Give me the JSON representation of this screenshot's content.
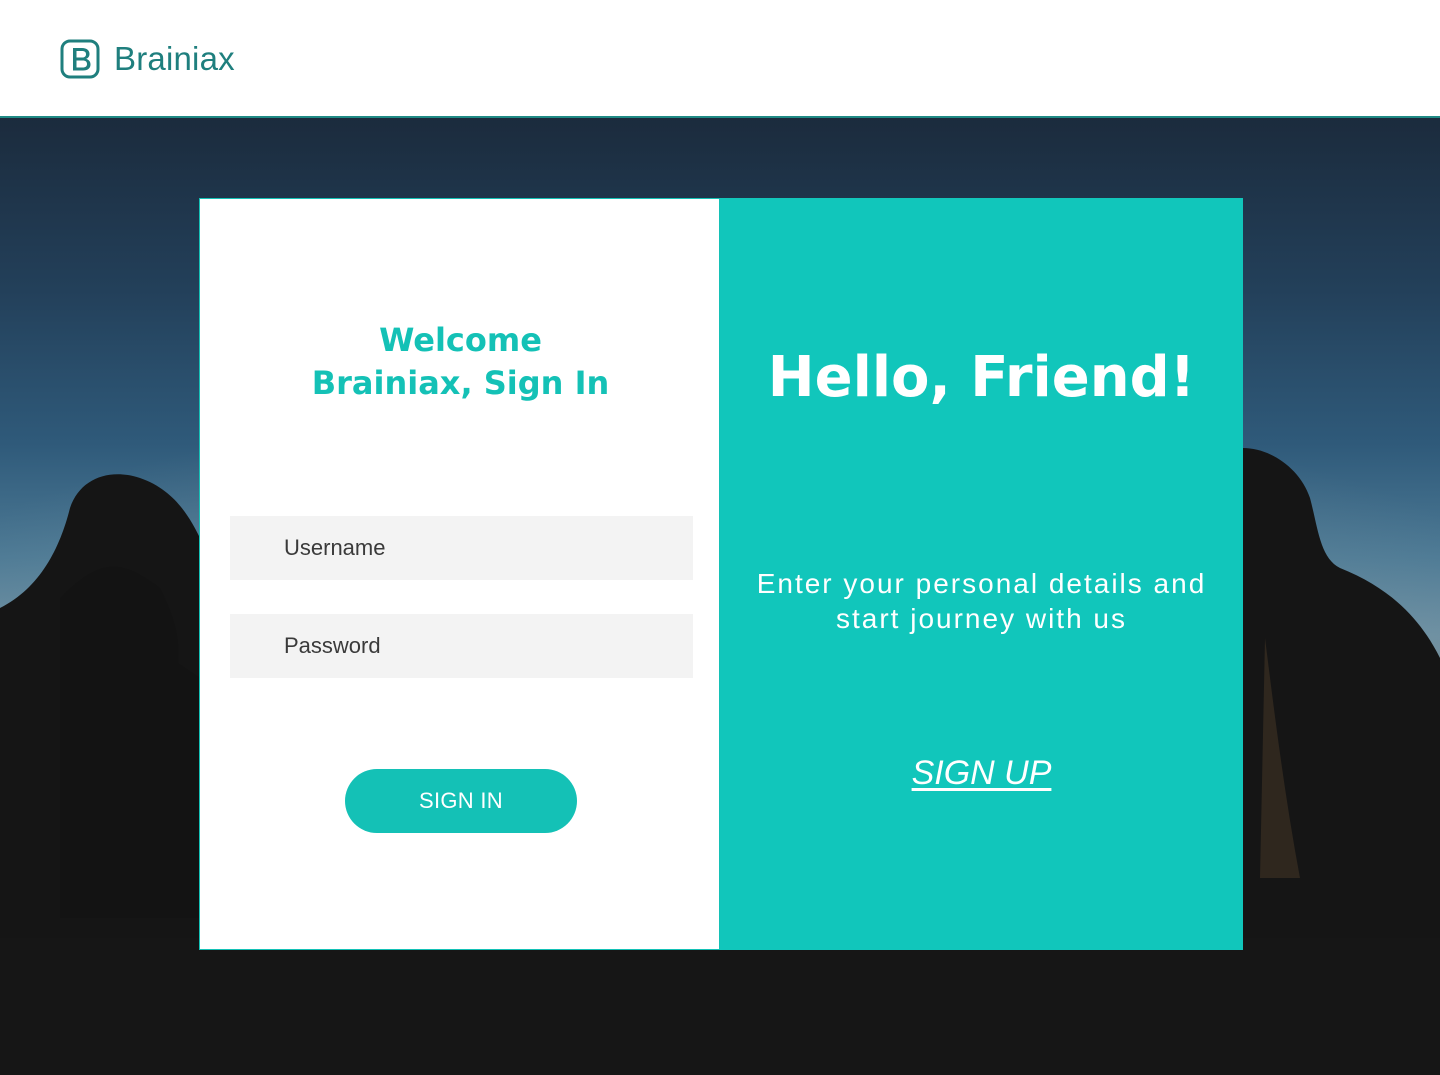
{
  "header": {
    "brand_name": "Brainiax",
    "logo_icon": "letter-b-rounded-square-icon",
    "brand_color": "#1f7f7e"
  },
  "login": {
    "title_line1": "Welcome",
    "title_line2": "Brainiax, Sign In",
    "username_placeholder": "Username",
    "password_placeholder": "Password",
    "signin_label": "SIGN IN"
  },
  "signup": {
    "title": "Hello, Friend!",
    "text_line1": "Enter your personal details and",
    "text_line2": "start journey with us",
    "signup_label": "SIGN UP"
  },
  "colors": {
    "accent": "#14c1b6",
    "panel_accent": "#11c6bb",
    "input_background": "#f3f3f3",
    "background_dark": "#161616"
  }
}
